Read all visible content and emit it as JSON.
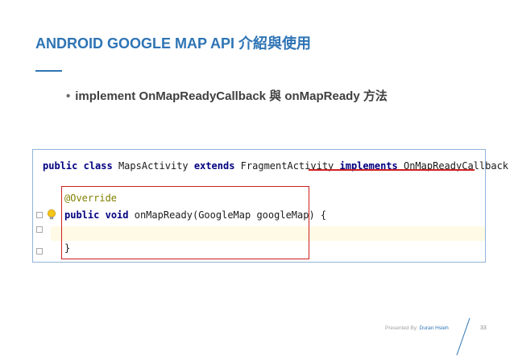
{
  "slide": {
    "title": "ANDROID GOOGLE MAP API 介紹與使用",
    "bullet_marker": "•",
    "bullet_text": "implement OnMapReadyCallback 與 onMapReady 方法"
  },
  "code": {
    "line1": {
      "kw1": "public",
      "kw2": "class",
      "name": " MapsActivity ",
      "kw3": "extends",
      "parent": " FragmentActivity ",
      "kw4": "implements",
      "iface": " OnMapReadyCallback {"
    },
    "annotation": "@Override",
    "line3": {
      "kw1": "public",
      "kw2": "void",
      "rest": " onMapReady(GoogleMap googleMap) {"
    },
    "closing_brace": "}"
  },
  "footer": {
    "presented_by": "Presented By:",
    "author": "Duran Hsieh",
    "page_number": "33"
  },
  "colors": {
    "title": "#2e74b5",
    "keyword": "#000080",
    "annotation": "#808000",
    "highlight_box": "#cc1f1f"
  },
  "icons": {
    "lightbulb": "lightbulb-icon"
  }
}
